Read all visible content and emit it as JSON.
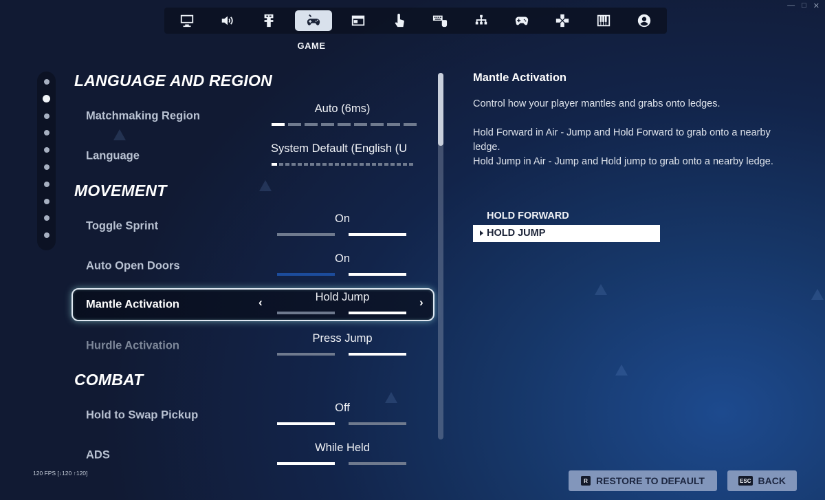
{
  "window_controls": {
    "minimize": "—",
    "maximize": "□",
    "close": "✕"
  },
  "tabs": [
    {
      "icon": "monitor-icon",
      "active": false
    },
    {
      "icon": "speaker-icon",
      "active": false
    },
    {
      "icon": "accessibility-icon",
      "active": false
    },
    {
      "icon": "game-tools-icon",
      "active": true,
      "caption": "GAME"
    },
    {
      "icon": "hud-window-icon",
      "active": false
    },
    {
      "icon": "touch-hand-icon",
      "active": false
    },
    {
      "icon": "keyboard-mouse-icon",
      "active": false
    },
    {
      "icon": "hierarchy-icon",
      "active": false
    },
    {
      "icon": "gamepad-icon",
      "active": false
    },
    {
      "icon": "dpad-icon",
      "active": false
    },
    {
      "icon": "piano-keys-icon",
      "active": false
    },
    {
      "icon": "account-icon",
      "active": false
    }
  ],
  "section_nav": {
    "count": 10,
    "active_index": 1
  },
  "sections": {
    "language_region": "LANGUAGE AND REGION",
    "movement": "MOVEMENT",
    "combat": "COMBAT"
  },
  "settings": {
    "matchmaking_region": {
      "label": "Matchmaking Region",
      "value": "Auto (6ms)"
    },
    "language": {
      "label": "Language",
      "value": "System Default (English (U"
    },
    "toggle_sprint": {
      "label": "Toggle Sprint",
      "value": "On"
    },
    "auto_open_doors": {
      "label": "Auto Open Doors",
      "value": "On"
    },
    "mantle_activation": {
      "label": "Mantle Activation",
      "value": "Hold Jump"
    },
    "hurdle_activation": {
      "label": "Hurdle Activation",
      "value": "Press Jump"
    },
    "hold_to_swap_pickup": {
      "label": "Hold to Swap Pickup",
      "value": "Off"
    },
    "ads": {
      "label": "ADS",
      "value": "While Held"
    }
  },
  "description": {
    "title": "Mantle Activation",
    "intro": "Control how your player mantles and grabs onto ledges.",
    "line1": "Hold Forward in Air - Jump and Hold Forward to grab onto a nearby ledge.",
    "line2": "Hold Jump in Air - Jump and Hold jump to grab onto a nearby ledge.",
    "options": [
      "HOLD FORWARD",
      "HOLD JUMP"
    ],
    "selected_option": "HOLD JUMP"
  },
  "fps": "120 FPS [↓120 ↑120]",
  "footer": {
    "restore_key": "R",
    "restore_label": "RESTORE TO DEFAULT",
    "back_key": "ESC",
    "back_label": "BACK"
  },
  "colors": {
    "accent_blue": "#1c4c9c",
    "focus_glow": "#9fe0dc",
    "button_bg": "#8296bb"
  }
}
